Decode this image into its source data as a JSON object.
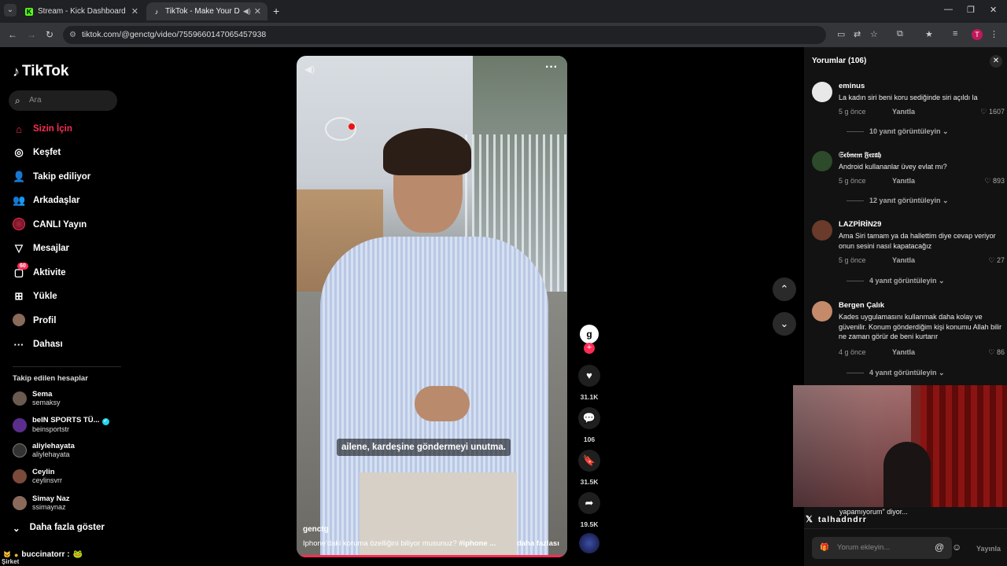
{
  "browser": {
    "tabs": [
      {
        "title": "Stream - Kick Dashboard",
        "favicon": "K"
      },
      {
        "title": "TikTok - Make Your Day",
        "favicon": "♪"
      }
    ],
    "url": "tiktok.com/@genctg/video/7559660147065457938",
    "profile_initial": "T"
  },
  "sidebar": {
    "logo": "TikTok",
    "search_placeholder": "Ara",
    "menu": [
      {
        "label": "Sizin İçin",
        "icon": "home-icon"
      },
      {
        "label": "Keşfet",
        "icon": "compass-icon"
      },
      {
        "label": "Takip ediliyor",
        "icon": "user-plus-icon"
      },
      {
        "label": "Arkadaşlar",
        "icon": "friends-icon"
      },
      {
        "label": "CANLI Yayın",
        "icon": "live-icon"
      },
      {
        "label": "Mesajlar",
        "icon": "send-icon"
      },
      {
        "label": "Aktivite",
        "icon": "inbox-icon",
        "badge": "60"
      },
      {
        "label": "Yükle",
        "icon": "upload-icon"
      },
      {
        "label": "Profil",
        "icon": "profile-avatar"
      },
      {
        "label": "Dahası",
        "icon": "more-icon"
      }
    ],
    "followed_title": "Takip edilen hesaplar",
    "accounts": [
      {
        "name": "Sema",
        "handle": "semaksy",
        "color": "#6a5a50"
      },
      {
        "name": "beIN SPORTS TÜ...",
        "handle": "beinsportstr",
        "color": "#5b2d8c",
        "verified": true
      },
      {
        "name": "aliylehayata",
        "handle": "aliylehayata",
        "color": "#333"
      },
      {
        "name": "Ceylin",
        "handle": "ceylinsvrr",
        "color": "#7a4a3a"
      },
      {
        "name": "Simay Naz",
        "handle": "ssimaynaz",
        "color": "#8a6a5a"
      }
    ],
    "show_more": "Daha fazla göster",
    "chat_user": "buccinatorr :",
    "chat_label": "Şirket"
  },
  "video": {
    "subtitle": "ailene, kardeşine göndermeyi unutma.",
    "username": "genctg",
    "description": "Iphone'daki koruma özelliğini biliyor musunuz?",
    "hashtag": "#iphone",
    "ellipsis": "...",
    "more": "daha fazlası",
    "progress": 0.985,
    "counts": {
      "likes": "31.1K",
      "comments": "106",
      "saves": "31.5K",
      "shares": "19.5K"
    },
    "avatar_letter": "g"
  },
  "comments": {
    "header": "Yorumlar (106)",
    "reply_label": "Yanıtla",
    "items": [
      {
        "name": "eminus",
        "text": "La kadın siri beni koru sediğinde siri açıldı la",
        "time": "5 g önce",
        "likes": "1607",
        "view": "10 yanıt görüntüleyin",
        "color": "#e8e8e8"
      },
      {
        "name": "𝔖𝔢𝔟𝔫𝔢𝔪 𝔉𝔢𝔯𝔞𝔥",
        "text": "Android kullananlar üvey evlat mı?",
        "time": "5 g önce",
        "likes": "893",
        "view": "12 yanıt görüntüleyin",
        "color": "#2d4a2a"
      },
      {
        "name": "LAZPİRİN29",
        "text": "Ama Siri tamam ya da hallettim diye cevap veriyor onun sesini nasıl kapatacağız",
        "time": "5 g önce",
        "likes": "27",
        "view": "4 yanıt görüntüleyin",
        "color": "#6a3a2a"
      },
      {
        "name": "Bergen Çalık",
        "text": "Kades uygulamasını kullanmak daha kolay ve güvenilir. Konum gönderdiğim kişi konumu Allah bilir ne zaman görür de beni kurtarır",
        "time": "4 g önce",
        "likes": "86",
        "view": "4 yanıt görüntüleyin",
        "color": "#c58a6a"
      }
    ],
    "partial_text": "yapamıyorum\" diyor...",
    "input_placeholder": "Yorum ekleyin...",
    "post_label": "Yayınla"
  },
  "webcam": {
    "name": "talhadndrr"
  }
}
